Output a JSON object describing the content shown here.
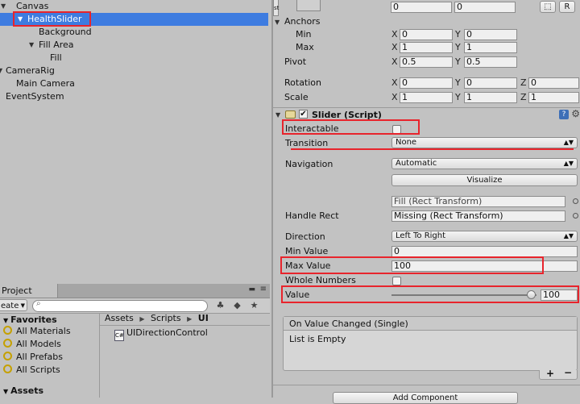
{
  "hierarchy": {
    "items": [
      {
        "label": "Canvas"
      },
      {
        "label": "HealthSlider"
      },
      {
        "label": "Background"
      },
      {
        "label": "Fill Area"
      },
      {
        "label": "Fill"
      },
      {
        "label": "CameraRig"
      },
      {
        "label": "Main Camera"
      },
      {
        "label": "EventSystem"
      }
    ]
  },
  "project": {
    "tab_label": "Project",
    "create_label": "eate",
    "breadcrumb": [
      "Assets",
      "Scripts",
      "UI"
    ],
    "favorites_header": "Favorites",
    "favorites": [
      "All Materials",
      "All Models",
      "All Prefabs",
      "All Scripts"
    ],
    "assets_header": "Assets",
    "files": [
      "UIDirectionControl"
    ]
  },
  "inspector": {
    "rect": {
      "top_values": [
        "0",
        "0"
      ],
      "r_button": "R",
      "anchors_label": "Anchors",
      "min_label": "Min",
      "max_label": "Max",
      "pivot_label": "Pivot",
      "rotation_label": "Rotation",
      "scale_label": "Scale",
      "anchor_min": {
        "x": "0",
        "y": "0"
      },
      "anchor_max": {
        "x": "1",
        "y": "1"
      },
      "pivot": {
        "x": "0.5",
        "y": "0.5"
      },
      "rotation": {
        "x": "0",
        "y": "0",
        "z": "0"
      },
      "scale": {
        "x": "1",
        "y": "1",
        "z": "1"
      }
    },
    "slider": {
      "title": "Slider (Script)",
      "interactable_label": "Interactable",
      "transition_label": "Transition",
      "transition_value": "None",
      "navigation_label": "Navigation",
      "navigation_value": "Automatic",
      "visualize_label": "Visualize",
      "fill_rect_value": "Fill (Rect Transform)",
      "handle_rect_label": "Handle Rect",
      "handle_rect_value": "Missing (Rect Transform)",
      "direction_label": "Direction",
      "direction_value": "Left To Right",
      "min_value_label": "Min Value",
      "min_value": "0",
      "max_value_label": "Max Value",
      "max_value": "100",
      "whole_numbers_label": "Whole Numbers",
      "value_label": "Value",
      "value": "100",
      "value_fraction": 1.0,
      "event_header": "On Value Changed (Single)",
      "event_body": "List is Empty",
      "add_component_label": "Add Component"
    },
    "axis": {
      "x": "X",
      "y": "Y",
      "z": "Z"
    }
  },
  "colors": {
    "selection": "#3e7ce0",
    "highlight": "#e8242c",
    "panel": "#c2c2c2"
  }
}
